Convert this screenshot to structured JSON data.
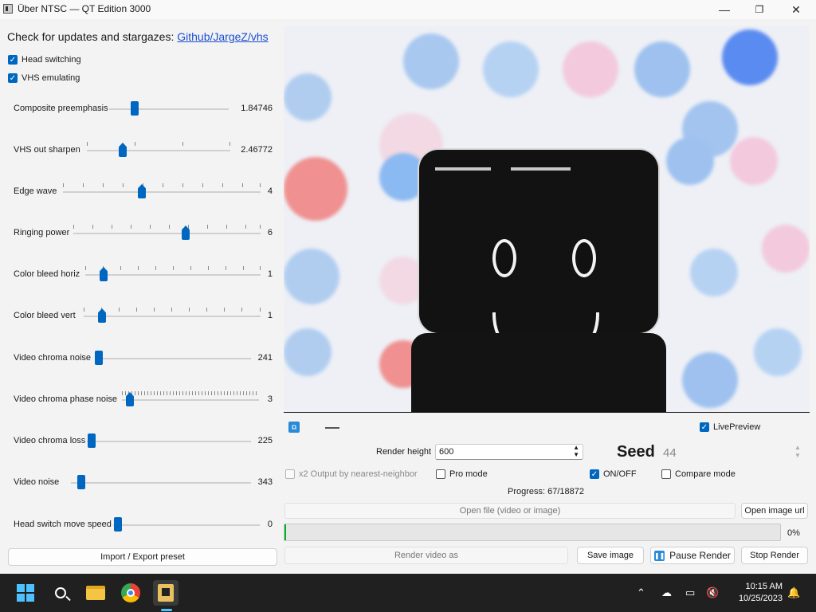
{
  "window": {
    "title": "Über NTSC — QT Edition 3000",
    "minimize": "—",
    "maximize": "❐",
    "close": "✕"
  },
  "left": {
    "updates_text": "Check for updates and stargazes:",
    "updates_link": "Github/JargeZ/vhs",
    "checkboxes": [
      {
        "label": "Head switching",
        "checked": true
      },
      {
        "label": "VHS emulating",
        "checked": true
      }
    ],
    "sliders": [
      {
        "label": "Composite preemphasis",
        "value": "1.84746",
        "level": 0.2
      },
      {
        "label": "VHS out sharpen",
        "value": "2.46772",
        "level": 0.25
      },
      {
        "label": "Edge wave",
        "value": "4",
        "level": 0.4
      },
      {
        "label": "Ringing power",
        "value": "6",
        "level": 0.6
      },
      {
        "label": "Color bleed horiz",
        "value": "1",
        "level": 0.1
      },
      {
        "label": "Color bleed vert",
        "value": "1",
        "level": 0.08
      },
      {
        "label": "Video chroma noise",
        "value": "241",
        "level": 0.02
      },
      {
        "label": "Video chroma phase noise",
        "value": "3",
        "level": 0.05
      },
      {
        "label": "Video chroma loss",
        "value": "225",
        "level": 0.01
      },
      {
        "label": "Video noise",
        "value": "343",
        "level": 0.05
      },
      {
        "label": "Head switch move speed",
        "value": "0",
        "level": 0.0
      }
    ],
    "import_export": "Import / Export preset"
  },
  "right": {
    "live_preview": "LivePreview",
    "render_height_label": "Render height",
    "render_height_value": "600",
    "seed_label": "Seed",
    "seed_value": "44",
    "x2_output": "x2 Output by nearest-neighbor",
    "pro_mode": "Pro mode",
    "onoff": "ON/OFF",
    "compare_mode": "Compare mode",
    "progress_text": "Progress: 67/18872",
    "open_file": "Open file (video or image)",
    "open_image_url": "Open image url",
    "progress_percent": "0%",
    "progress_fraction": 0.004,
    "render_video_as": "Render video as",
    "save_image": "Save image",
    "pause_render": "Pause Render",
    "stop_render": "Stop Render"
  },
  "taskbar": {
    "time": "10:15 AM",
    "date": "10/25/2023"
  },
  "colors": {
    "accent": "#0067c0",
    "progress": "#06b025",
    "taskbar": "#202020"
  }
}
